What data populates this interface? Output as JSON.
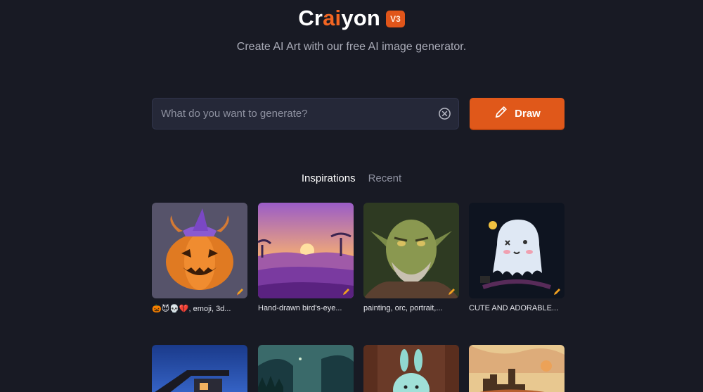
{
  "header": {
    "logo_prefix": "Cr",
    "logo_ai": "ai",
    "logo_suffix": "yon",
    "version_badge": "V3",
    "tagline": "Create AI Art with our free AI image generator."
  },
  "search": {
    "placeholder": "What do you want to generate?",
    "value": ""
  },
  "draw_button": {
    "label": "Draw"
  },
  "tabs": [
    {
      "label": "Inspirations",
      "active": true
    },
    {
      "label": "Recent",
      "active": false
    }
  ],
  "gallery": {
    "row1": [
      {
        "caption": "🎃😈💀💔, emoji, 3d..."
      },
      {
        "caption": "Hand-drawn bird's-eye..."
      },
      {
        "caption": "painting, orc, portrait,..."
      },
      {
        "caption": "CUTE AND ADORABLE..."
      }
    ]
  },
  "colors": {
    "background": "#181a24",
    "accent": "#e0581a",
    "input_bg": "#252838"
  }
}
